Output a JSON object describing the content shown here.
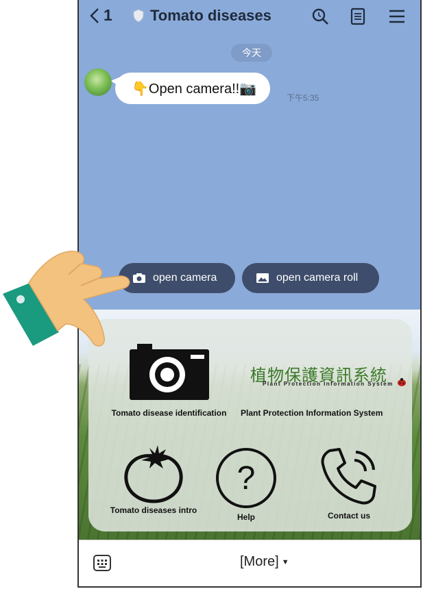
{
  "header": {
    "back_count": "1",
    "title": "Tomato diseases",
    "icons": [
      "search-icon",
      "notes-icon",
      "menu-icon"
    ]
  },
  "chat": {
    "date_label": "今天",
    "message_text": "👇Open camera!!📷",
    "message_time": "下午5:35"
  },
  "quick_replies": {
    "camera_label": "open camera",
    "camera_roll_label": "open camera roll"
  },
  "rich_menu": {
    "identify_label": "Tomato disease identification",
    "ppis_label": "Plant Protection Information System",
    "ppis_logo_cn": "植物保護資訊系統",
    "ppis_logo_en": "Plant Protection Information System",
    "intro_label": "Tomato diseases intro",
    "help_label": "Help",
    "contact_label": "Contact us"
  },
  "bottom_bar": {
    "more_label": "[More]"
  },
  "colors": {
    "chat_background": "#8aaad9",
    "quick_reply_bg": "#3e4d6b",
    "cuff": "#1a9a7e",
    "hand": "#f3c27e"
  }
}
